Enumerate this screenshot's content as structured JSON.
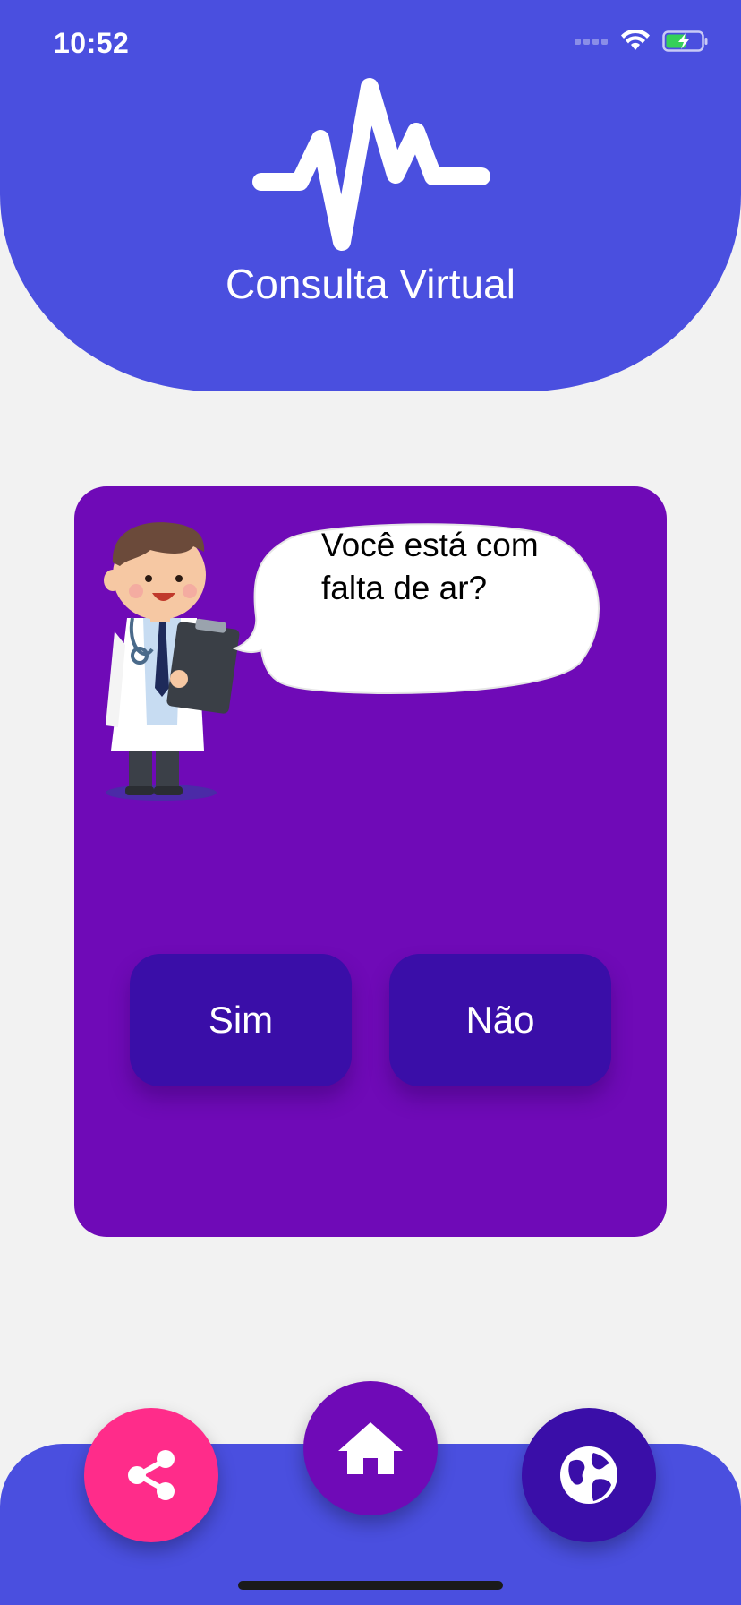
{
  "status_bar": {
    "time": "10:52"
  },
  "header": {
    "title": "Consulta Virtual",
    "logo_icon": "heartbeat-pulse-icon"
  },
  "question_card": {
    "question": "Você está com falta de ar?",
    "options": {
      "yes": "Sim",
      "no": "Não"
    }
  },
  "bottom_nav": {
    "share_icon": "share-icon",
    "home_icon": "home-icon",
    "globe_icon": "globe-icon"
  },
  "colors": {
    "header_blue": "#4a4fdf",
    "card_purple": "#6f0ab7",
    "button_indigo": "#3a0ea8",
    "share_pink": "#ff2c8a",
    "background": "#f2f2f2"
  }
}
